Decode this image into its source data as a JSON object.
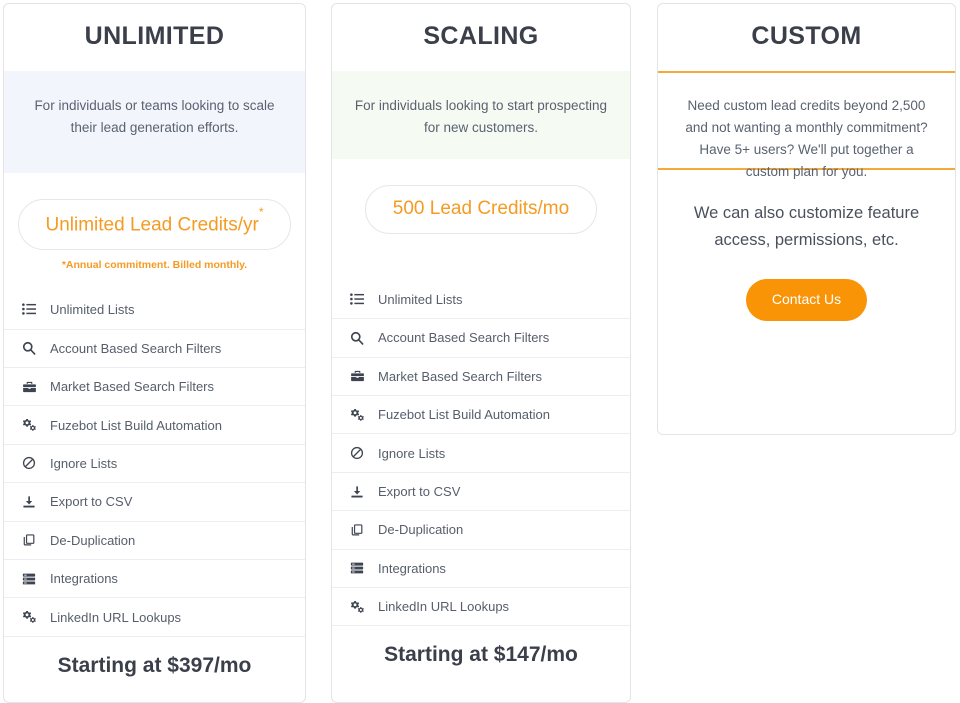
{
  "plans": [
    {
      "id": "unlimited",
      "title": "UNLIMITED",
      "description": "For individuals or teams looking to scale their lead generation efforts.",
      "price_pill": "Unlimited Lead Credits/yr",
      "price_pill_marker": "*",
      "price_note": "*Annual commitment. Billed monthly.",
      "footer_price": "Starting at $397/mo",
      "band_color": "#f2f5fc",
      "features": [
        {
          "icon": "list-icon",
          "label": "Unlimited Lists"
        },
        {
          "icon": "search-icon",
          "label": "Account Based Search Filters"
        },
        {
          "icon": "briefcase-icon",
          "label": "Market Based Search Filters"
        },
        {
          "icon": "cogs-icon",
          "label": "Fuzebot List Build Automation"
        },
        {
          "icon": "ban-icon",
          "label": "Ignore Lists"
        },
        {
          "icon": "download-icon",
          "label": "Export to CSV"
        },
        {
          "icon": "copy-icon",
          "label": "De-Duplication"
        },
        {
          "icon": "server-icon",
          "label": "Integrations"
        },
        {
          "icon": "cogs-icon",
          "label": "LinkedIn URL Lookups"
        }
      ]
    },
    {
      "id": "scaling",
      "title": "SCALING",
      "description": "For individuals looking to start prospecting for new customers.",
      "price_pill": "500 Lead Credits/mo",
      "price_pill_marker": "",
      "price_note": "",
      "footer_price": "Starting at $147/mo",
      "band_color": "#f5fbf3",
      "features": [
        {
          "icon": "list-icon",
          "label": "Unlimited Lists"
        },
        {
          "icon": "search-icon",
          "label": "Account Based Search Filters"
        },
        {
          "icon": "briefcase-icon",
          "label": "Market Based Search Filters"
        },
        {
          "icon": "cogs-icon",
          "label": "Fuzebot List Build Automation"
        },
        {
          "icon": "ban-icon",
          "label": "Ignore Lists"
        },
        {
          "icon": "download-icon",
          "label": "Export to CSV"
        },
        {
          "icon": "copy-icon",
          "label": "De-Duplication"
        },
        {
          "icon": "server-icon",
          "label": "Integrations"
        },
        {
          "icon": "cogs-icon",
          "label": "LinkedIn URL Lookups"
        }
      ]
    }
  ],
  "custom": {
    "id": "custom",
    "title": "CUSTOM",
    "description": "Need custom lead credits beyond 2,500 and not wanting a monthly commitment? Have 5+ users? We'll put together a custom plan for you.",
    "note": "We can also customize feature access, permissions, etc.",
    "cta_label": "Contact Us",
    "accent_color": "#f6a93b",
    "cta_color": "#f89406"
  },
  "theme": {
    "accent": "#f59b23",
    "heading_color": "#3a3f4a",
    "body_text_color": "#5a6270",
    "border_color": "#e2e4e8",
    "divider_color": "#eceef1"
  }
}
